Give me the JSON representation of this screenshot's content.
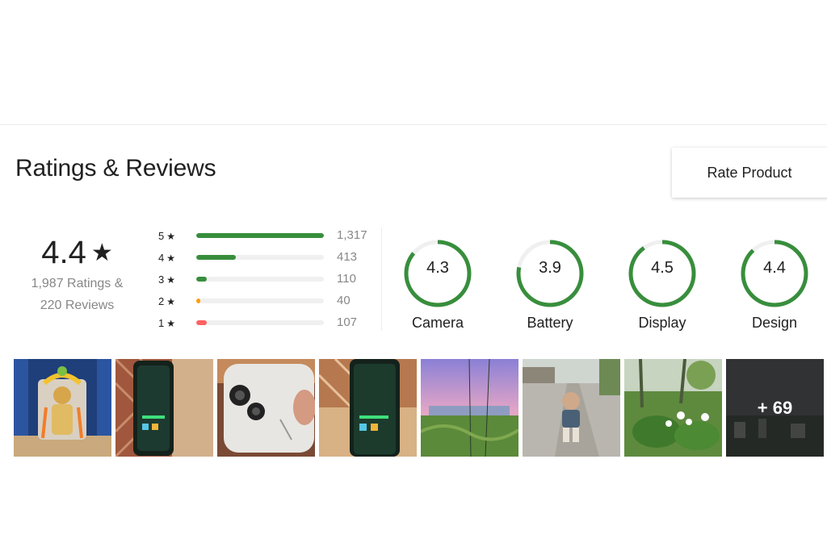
{
  "section_title": "Ratings & Reviews",
  "rate_button": "Rate Product",
  "overall": {
    "average": "4.4",
    "star": "★",
    "ratings_line": "1,987 Ratings &",
    "reviews_line": "220 Reviews"
  },
  "distribution": [
    {
      "stars": "5",
      "star": "★",
      "count": "1,317",
      "fraction": 1.0,
      "color": "#388e3c"
    },
    {
      "stars": "4",
      "star": "★",
      "count": "413",
      "fraction": 0.31,
      "color": "#388e3c"
    },
    {
      "stars": "3",
      "star": "★",
      "count": "110",
      "fraction": 0.084,
      "color": "#388e3c"
    },
    {
      "stars": "2",
      "star": "★",
      "count": "40",
      "fraction": 0.03,
      "color": "#ff9f00"
    },
    {
      "stars": "1",
      "star": "★",
      "count": "107",
      "fraction": 0.081,
      "color": "#ff6161"
    }
  ],
  "aspects": [
    {
      "value": "4.3",
      "label": "Camera",
      "fraction": 0.86
    },
    {
      "value": "3.9",
      "label": "Battery",
      "fraction": 0.78
    },
    {
      "value": "4.5",
      "label": "Display",
      "fraction": 0.9
    },
    {
      "value": "4.4",
      "label": "Design",
      "fraction": 0.88
    }
  ],
  "colors": {
    "ring": "#388e3c",
    "ring_track": "#f0f0f0"
  },
  "gallery": {
    "photos": [
      {
        "name": "photo-shrine"
      },
      {
        "name": "photo-phone-on-cloth"
      },
      {
        "name": "photo-phone-back-camera"
      },
      {
        "name": "photo-phone-screen"
      },
      {
        "name": "photo-sunset-field"
      },
      {
        "name": "photo-child-on-road"
      },
      {
        "name": "photo-garden-flowers"
      }
    ],
    "more_label": "+ 69"
  }
}
